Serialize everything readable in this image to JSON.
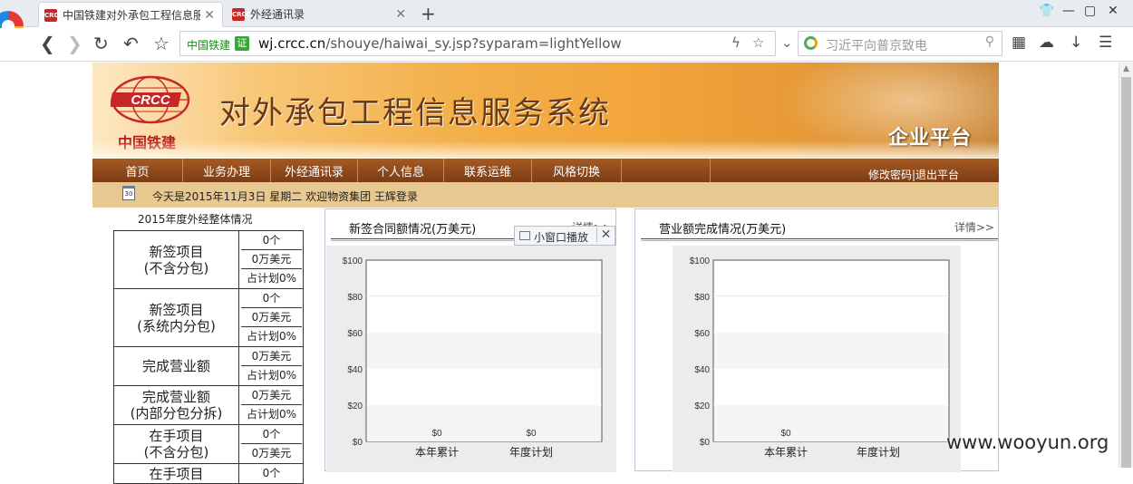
{
  "browser": {
    "tabs": [
      {
        "title": "中国铁建对外承包工程信息服务系统",
        "favicon": "CRCC",
        "active": true
      },
      {
        "title": "外经通讯录",
        "favicon": "CRCC",
        "active": false
      }
    ],
    "new_tab": "+",
    "url": {
      "site_name": "中国铁建",
      "verify_badge": "证",
      "host": "wj.crcc.cn",
      "path": "/shouye/haiwai_sy.jsp?syparam=lightYellow"
    },
    "search_placeholder": "习近平向普京致电",
    "icons": [
      "back-icon",
      "forward-icon",
      "reload-icon",
      "undo-icon",
      "star-icon",
      "lightning-icon",
      "bookmark-star-icon",
      "chevron-down-icon",
      "search-icon",
      "apps-icon",
      "cloud-icon",
      "download-icon",
      "menu-icon"
    ]
  },
  "site": {
    "logo_text": "CRCC",
    "logo_subtitle": "中国铁建",
    "title": "对外承包工程信息服务系统",
    "tagline": "企业平台",
    "nav": [
      "首页",
      "业务办理",
      "外经通讯录",
      "个人信息",
      "联系运维",
      "风格切换",
      ""
    ],
    "nav_right": "修改密码|退出平台",
    "calendar_label": "30",
    "info_line": "今天是2015年11月3日 星期二  欢迎物资集团  王辉登录"
  },
  "summary": {
    "title": "2015年度外经整体情况",
    "rows": [
      {
        "label": "新签项目\n(不含分包)",
        "values": [
          "0个",
          "0万美元",
          "占计划0%"
        ]
      },
      {
        "label": "新签项目\n(系统内分包)",
        "values": [
          "0个",
          "0万美元",
          "占计划0%"
        ]
      },
      {
        "label": "完成营业额",
        "values": [
          "0万美元",
          "占计划0%"
        ]
      },
      {
        "label": "完成营业额\n(内部分包分拆)",
        "values": [
          "0万美元",
          "占计划0%"
        ]
      },
      {
        "label": "在手项目\n(不含分包)",
        "values": [
          "0个",
          "0万美元"
        ]
      },
      {
        "label": "在手项目",
        "values": [
          "0个"
        ]
      }
    ]
  },
  "panels": [
    {
      "title": "新签合同额情况(万美元)",
      "more": "详情>>"
    },
    {
      "title": "营业额完成情况(万美元)",
      "more": "详情>>"
    }
  ],
  "pip": {
    "label": "小窗口播放",
    "close": "✕"
  },
  "watermark": "www.wooyun.org",
  "colors": {
    "nav_bg": "#8a4518",
    "info_bg": "#e8c891",
    "accent_red": "#b71c1c",
    "annotation_arrow": "#e53935"
  },
  "chart_data": [
    {
      "type": "bar",
      "title": "新签合同额情况(万美元)",
      "categories": [
        "本年累计",
        "年度计划"
      ],
      "values": [
        0,
        0
      ],
      "data_labels": [
        "$0",
        "$0"
      ],
      "ylim": [
        0,
        100
      ],
      "yticks": [
        "$0",
        "$20",
        "$40",
        "$60",
        "$80",
        "$100"
      ],
      "grid": true
    },
    {
      "type": "bar",
      "title": "营业额完成情况(万美元)",
      "categories": [
        "本年累计",
        "年度计划"
      ],
      "values": [
        0,
        null
      ],
      "data_labels": [
        "$0",
        ""
      ],
      "ylim": [
        0,
        100
      ],
      "yticks": [
        "$0",
        "$20",
        "$40",
        "$60",
        "$80",
        "$100"
      ],
      "grid": true
    }
  ]
}
